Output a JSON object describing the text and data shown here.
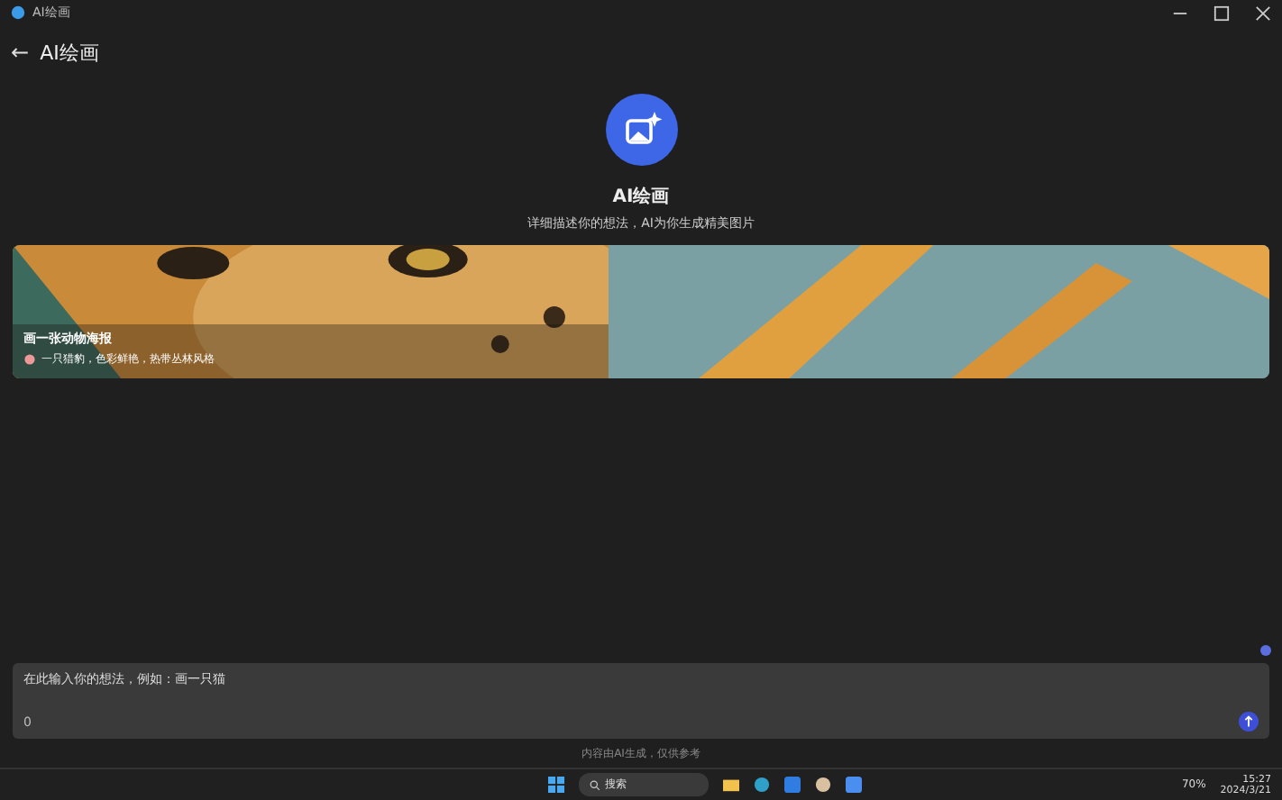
{
  "window": {
    "title": "AI绘画"
  },
  "header": {
    "back": "←",
    "title": "AI绘画"
  },
  "hero": {
    "title": "AI绘画",
    "subtitle": "详细描述你的想法，AI为你生成精美图片"
  },
  "banner": {
    "title": "画一张动物海报",
    "caption": "一只猎豹，色彩鲜艳，热带丛林风格"
  },
  "composer": {
    "placeholder": "在此输入你的想法，例如：画一只猫",
    "counter": "0"
  },
  "footer": "内容由AI生成，仅供参考",
  "taskbar": {
    "search": "搜索",
    "battery": "70%",
    "time": "15:27",
    "date": "2024/3/21"
  }
}
